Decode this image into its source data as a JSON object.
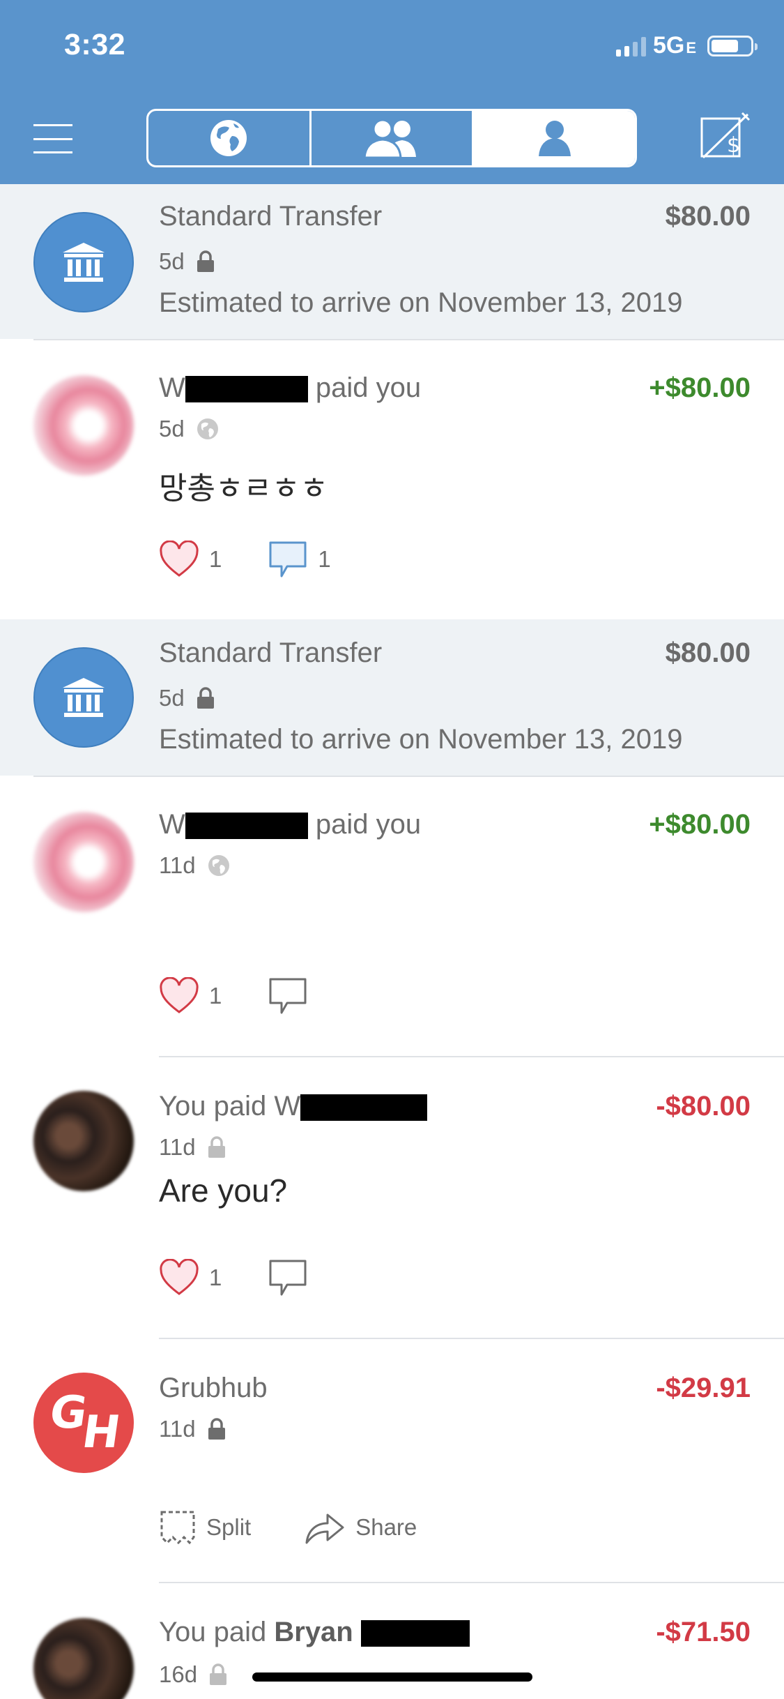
{
  "status_bar": {
    "time": "3:32",
    "network": "5G",
    "network_suffix": "E"
  },
  "nav": {
    "menu_icon": "hamburger-menu-icon",
    "tabs": [
      {
        "icon": "globe-icon",
        "name": "public"
      },
      {
        "icon": "friends-icon",
        "name": "friends"
      },
      {
        "icon": "person-icon",
        "name": "mine",
        "selected": true
      }
    ],
    "compose_icon": "pay-request-icon"
  },
  "colors": {
    "header": "#5a94cc",
    "positive": "#3d8a2d",
    "negative": "#d23a45",
    "highlight_row": "#eef2f5"
  },
  "feed": [
    {
      "type": "transfer",
      "title": "Standard Transfer",
      "amount": "$80.00",
      "time": "5d",
      "privacy_icon": "lock-icon",
      "subtext": "Estimated to arrive on November 13, 2019"
    },
    {
      "type": "payment",
      "title_prefix": "W",
      "title_suffix": "paid you",
      "amount": "+$80.00",
      "time": "5d",
      "privacy_icon": "globe-icon",
      "note": "망총ㅎㄹㅎㅎ",
      "likes": "1",
      "comments": "1"
    },
    {
      "type": "transfer",
      "title": "Standard Transfer",
      "amount": "$80.00",
      "time": "5d",
      "privacy_icon": "lock-icon",
      "subtext": "Estimated to arrive on November 13, 2019"
    },
    {
      "type": "payment",
      "title_prefix": "W",
      "title_suffix": "paid you",
      "amount": "+$80.00",
      "time": "11d",
      "privacy_icon": "globe-icon",
      "likes": "1"
    },
    {
      "type": "payment",
      "title_prefix": "You paid W",
      "amount": "-$80.00",
      "time": "11d",
      "privacy_icon": "lock-icon",
      "note": "Are you?",
      "likes": "1"
    },
    {
      "type": "merchant",
      "title": "Grubhub",
      "amount": "-$29.91",
      "time": "11d",
      "privacy_icon": "lock-icon",
      "split_label": "Split",
      "share_label": "Share"
    },
    {
      "type": "payment",
      "title_prefix": "You paid ",
      "title_bold": "Bryan",
      "amount": "-$71.50",
      "time": "16d",
      "privacy_icon": "lock-icon"
    }
  ]
}
